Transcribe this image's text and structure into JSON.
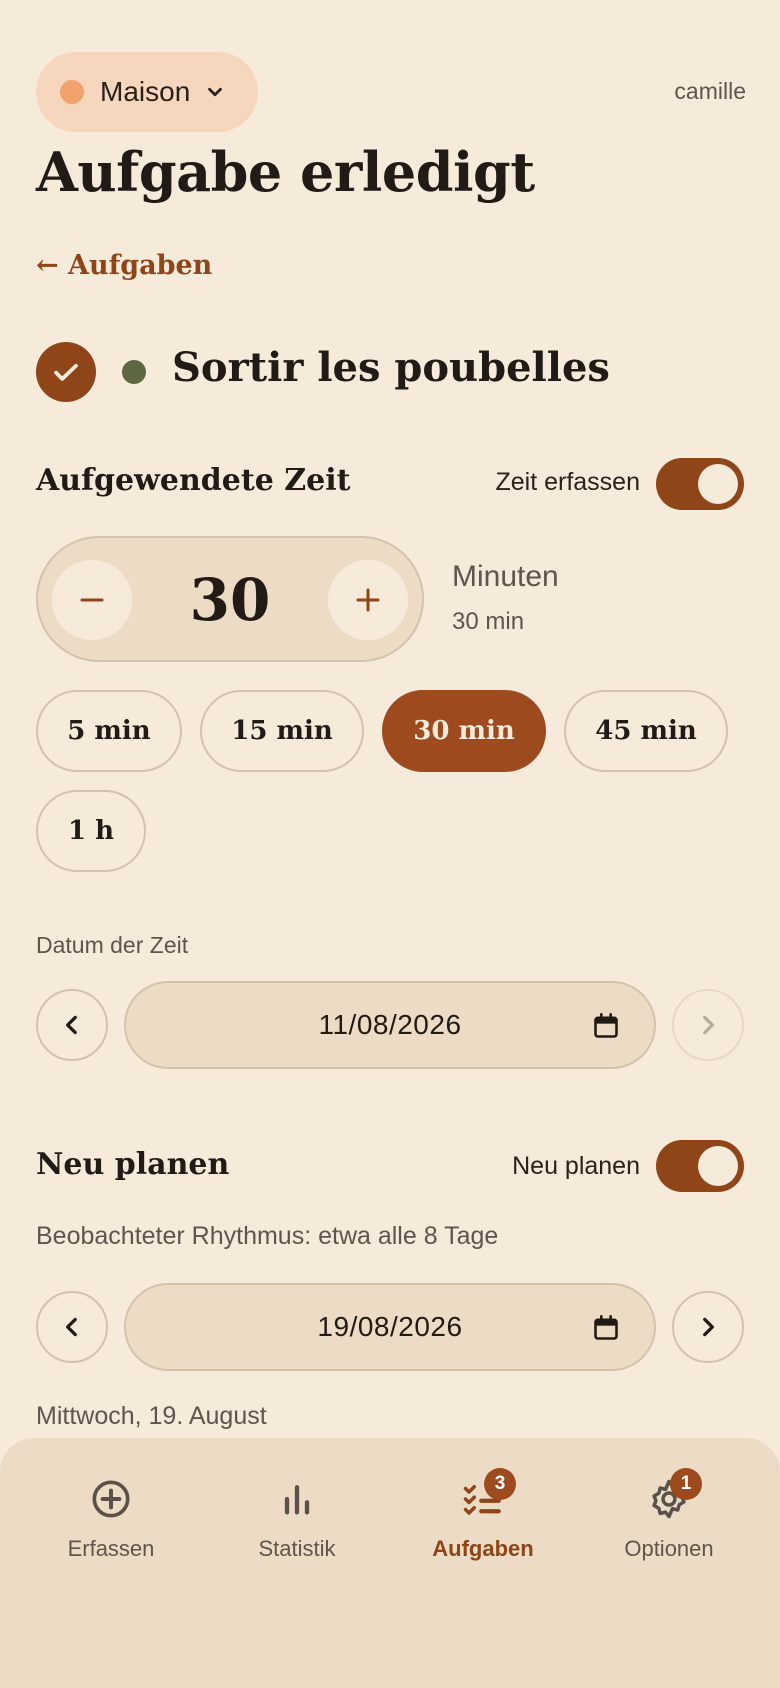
{
  "header": {
    "house_name": "Maison",
    "user": "camille",
    "title": "Aufgabe erledigt",
    "back_label": "← Aufgaben"
  },
  "task": {
    "name": "Sortir les poubelles"
  },
  "time_section": {
    "title": "Aufgewendete Zeit",
    "toggle_label": "Zeit erfassen",
    "toggle_on": true,
    "value": "30",
    "unit": "Minuten",
    "unit_summary": "30 min",
    "minus": "−",
    "plus": "+",
    "chips": [
      "5 min",
      "15 min",
      "30 min",
      "45 min",
      "1 h"
    ],
    "selected_chip": "30 min"
  },
  "time_date": {
    "label": "Datum der Zeit",
    "value": "11/08/2026"
  },
  "reschedule": {
    "title": "Neu planen",
    "toggle_label": "Neu planen",
    "toggle_on": true,
    "rhythm": "Beobachteter Rhythmus: etwa alle 8 Tage",
    "date": "19/08/2026",
    "weekday_text": "Mittwoch, 19. August"
  },
  "bottom_nav": {
    "items": [
      {
        "label": "Erfassen",
        "icon": "plus-circle-icon"
      },
      {
        "label": "Statistik",
        "icon": "bar-chart-icon"
      },
      {
        "label": "Aufgaben",
        "icon": "checklist-icon",
        "badge": "3",
        "active": true
      },
      {
        "label": "Optionen",
        "icon": "gear-icon",
        "badge": "1"
      }
    ]
  },
  "colors": {
    "background": "#f6eadb",
    "accent": "#8f4517",
    "house_dot": "#f2a26c",
    "task_dot": "#5e6741"
  }
}
